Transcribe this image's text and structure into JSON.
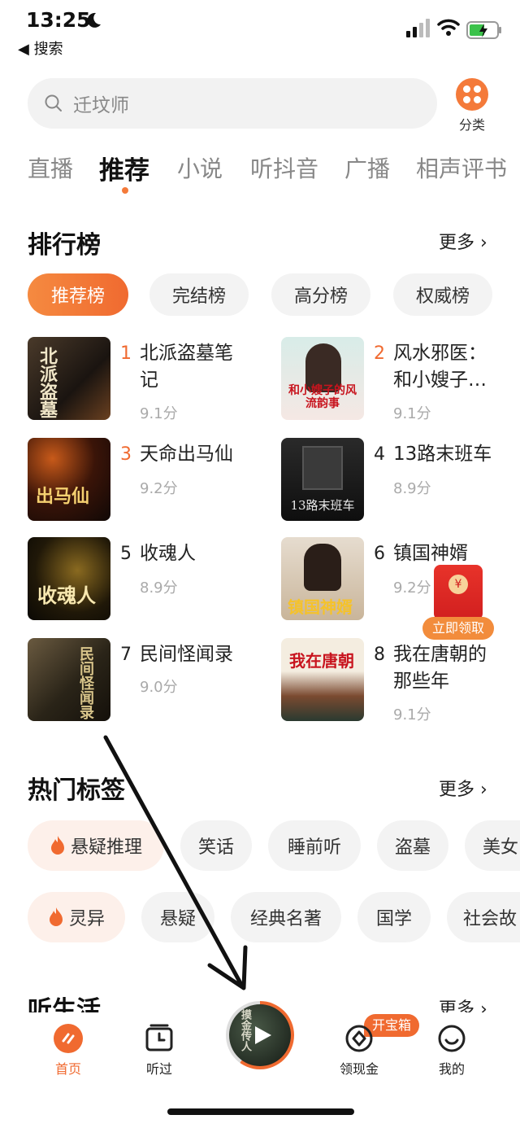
{
  "status": {
    "time": "13:25",
    "back": "◀ 搜索"
  },
  "search": {
    "placeholder": "迁坟师"
  },
  "category": {
    "label": "分类"
  },
  "tabs": [
    "直播",
    "推荐",
    "小说",
    "听抖音",
    "广播",
    "相声评书"
  ],
  "ranking": {
    "title": "排行榜",
    "more": "更多",
    "pills": [
      "推荐榜",
      "完结榜",
      "高分榜",
      "权威榜"
    ],
    "books": [
      {
        "rank": "1",
        "name": "北派盗墓笔记",
        "score": "9.1分",
        "cover_text": "北派盗墓"
      },
      {
        "rank": "2",
        "name": "风水邪医：和小嫂子…",
        "score": "9.1分",
        "cover_text": "和小嫂子的风流韵事"
      },
      {
        "rank": "3",
        "name": "天命出马仙",
        "score": "9.2分",
        "cover_text": "出马仙"
      },
      {
        "rank": "4",
        "name": "13路末班车",
        "score": "8.9分",
        "cover_text": "13路末班车"
      },
      {
        "rank": "5",
        "name": "收魂人",
        "score": "8.9分",
        "cover_text": "收魂人"
      },
      {
        "rank": "6",
        "name": "镇国神婿",
        "score": "9.2分",
        "cover_text": "镇国神婿"
      },
      {
        "rank": "7",
        "name": "民间怪闻录",
        "score": "9.0分",
        "cover_text": "民间怪闻录"
      },
      {
        "rank": "8",
        "name": "我在唐朝的那些年",
        "score": "9.1分",
        "cover_text": "我在唐朝"
      }
    ]
  },
  "red_packet": {
    "label": "立即领取"
  },
  "hot_tags": {
    "title": "热门标签",
    "more": "更多",
    "row1": [
      "悬疑推理",
      "笑话",
      "睡前听",
      "盗墓",
      "美女"
    ],
    "row2": [
      "灵异",
      "悬疑",
      "经典名著",
      "国学",
      "社会故"
    ]
  },
  "life": {
    "title": "听生活",
    "more": "更多"
  },
  "bottom_nav": {
    "home": "首页",
    "history": "听过",
    "cash": "领现金",
    "cash_badge": "开宝箱",
    "me": "我的",
    "player_cover_text": "摸金传人"
  },
  "colors": {
    "accent": "#f06a30",
    "red_packet": "#e8332a"
  }
}
